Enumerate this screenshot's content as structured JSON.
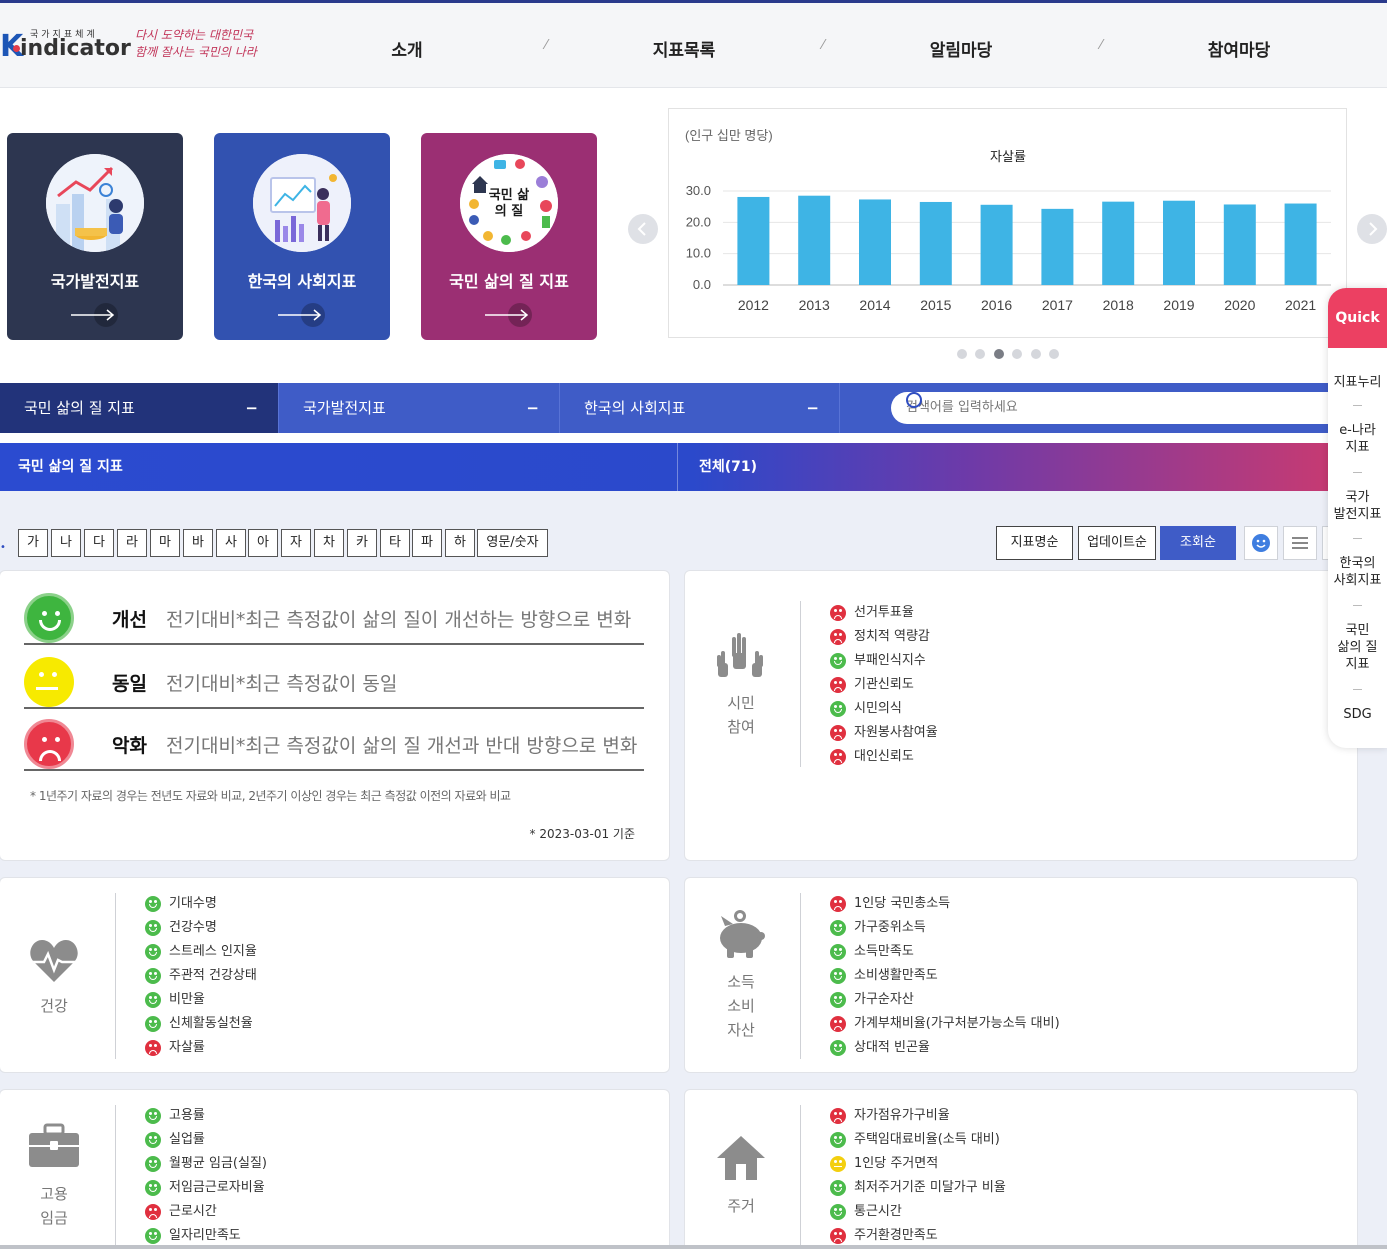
{
  "header": {
    "logo_small": "국가지표체계",
    "logo_text": "indicator",
    "logo_letter": "K",
    "slogan_line1": "다시 도약하는 대한민국",
    "slogan_line2": "함께 잘사는 국민의 나라",
    "nav": [
      "소개",
      "지표목록",
      "알림마당",
      "참여마당"
    ]
  },
  "cards": [
    {
      "title": "국가발전지표",
      "color": "#2d3650"
    },
    {
      "title": "한국의 사회지표",
      "color": "#3252b0"
    },
    {
      "title": "국민 삶의 질 지표",
      "color": "#9b2f73",
      "circle_text": "국민 삶의 질"
    }
  ],
  "chart_data": {
    "type": "bar",
    "title": "자살률",
    "unit_label": "(인구 십만 명당)",
    "categories": [
      "2012",
      "2013",
      "2014",
      "2015",
      "2016",
      "2017",
      "2018",
      "2019",
      "2020",
      "2021"
    ],
    "values": [
      28.1,
      28.5,
      27.3,
      26.5,
      25.6,
      24.3,
      26.6,
      26.9,
      25.7,
      26.0
    ],
    "yticks": [
      "0.0",
      "10.0",
      "20.0",
      "30.0"
    ],
    "ylim": [
      0,
      30
    ],
    "bar_color": "#3eb4e5",
    "grid": true
  },
  "slider": {
    "dots": 6,
    "active": 2
  },
  "tabs": [
    {
      "label": "국민 삶의 질 지표",
      "active": true
    },
    {
      "label": "국가발전지표",
      "active": false
    },
    {
      "label": "한국의 사회지표",
      "active": false
    }
  ],
  "search": {
    "placeholder": "검색어를 입력하세요"
  },
  "subbar": {
    "left": "국민 삶의 질 지표",
    "right": "전체(71)"
  },
  "korean_index": [
    "가",
    "나",
    "다",
    "라",
    "마",
    "바",
    "사",
    "아",
    "자",
    "차",
    "카",
    "타",
    "파",
    "하",
    "영문/숫자"
  ],
  "sort_buttons": [
    {
      "label": "지표명순",
      "active": false
    },
    {
      "label": "업데이트순",
      "active": false
    },
    {
      "label": "조회순",
      "active": true
    }
  ],
  "legend": {
    "rows": [
      {
        "status": "good",
        "label": "개선",
        "desc": "전기대비*최근 측정값이 삶의 질이 개선하는 방향으로 변화"
      },
      {
        "status": "same",
        "label": "동일",
        "desc": "전기대비*최근 측정값이 동일"
      },
      {
        "status": "bad",
        "label": "악화",
        "desc": "전기대비*최근 측정값이 삶의 질 개선과 반대 방향으로 변화"
      }
    ],
    "footnote": "* 1년주기 자료의 경우는 전년도 자료와 비교, 2년주기 이상인 경우는 최근 측정값 이전의 자료와 비교",
    "date": "* 2023-03-01 기준"
  },
  "categories": [
    {
      "key": "civic",
      "label_lines": [
        "시민",
        "참여"
      ],
      "icon": "raised-hands-icon",
      "items": [
        {
          "name": "선거투표율",
          "status": "bad"
        },
        {
          "name": "정치적 역량감",
          "status": "bad"
        },
        {
          "name": "부패인식지수",
          "status": "good"
        },
        {
          "name": "기관신뢰도",
          "status": "bad"
        },
        {
          "name": "시민의식",
          "status": "good"
        },
        {
          "name": "자원봉사참여율",
          "status": "bad"
        },
        {
          "name": "대인신뢰도",
          "status": "bad"
        }
      ]
    },
    {
      "key": "health",
      "label_lines": [
        "건강"
      ],
      "icon": "heart-pulse-icon",
      "items": [
        {
          "name": "기대수명",
          "status": "good"
        },
        {
          "name": "건강수명",
          "status": "good"
        },
        {
          "name": "스트레스 인지율",
          "status": "good"
        },
        {
          "name": "주관적 건강상태",
          "status": "good"
        },
        {
          "name": "비만율",
          "status": "good"
        },
        {
          "name": "신체활동실천율",
          "status": "good"
        },
        {
          "name": "자살률",
          "status": "bad"
        }
      ]
    },
    {
      "key": "income",
      "label_lines": [
        "소득",
        "소비",
        "자산"
      ],
      "icon": "piggy-bank-icon",
      "items": [
        {
          "name": "1인당 국민총소득",
          "status": "bad"
        },
        {
          "name": "가구중위소득",
          "status": "good"
        },
        {
          "name": "소득만족도",
          "status": "good"
        },
        {
          "name": "소비생활만족도",
          "status": "good"
        },
        {
          "name": "가구순자산",
          "status": "good"
        },
        {
          "name": "가계부채비율(가구처분가능소득 대비)",
          "status": "bad"
        },
        {
          "name": "상대적 빈곤율",
          "status": "good"
        }
      ]
    },
    {
      "key": "employment",
      "label_lines": [
        "고용",
        "임금"
      ],
      "icon": "briefcase-icon",
      "items": [
        {
          "name": "고용률",
          "status": "good"
        },
        {
          "name": "실업률",
          "status": "good"
        },
        {
          "name": "월평균 임금(실질)",
          "status": "good"
        },
        {
          "name": "저임금근로자비율",
          "status": "good"
        },
        {
          "name": "근로시간",
          "status": "bad"
        },
        {
          "name": "일자리만족도",
          "status": "good"
        }
      ]
    },
    {
      "key": "housing",
      "label_lines": [
        "주거"
      ],
      "icon": "house-icon",
      "items": [
        {
          "name": "자가점유가구비율",
          "status": "bad"
        },
        {
          "name": "주택임대료비율(소득 대비)",
          "status": "good"
        },
        {
          "name": "1인당 주거면적",
          "status": "same"
        },
        {
          "name": "최저주거기준 미달가구 비율",
          "status": "good"
        },
        {
          "name": "통근시간",
          "status": "good"
        },
        {
          "name": "주거환경만족도",
          "status": "bad"
        }
      ]
    }
  ],
  "quick": {
    "title": "Quick",
    "items": [
      [
        "지표누리"
      ],
      [
        "e-나라",
        "지표"
      ],
      [
        "국가",
        "발전지표"
      ],
      [
        "한국의",
        "사회지표"
      ],
      [
        "국민",
        "삶의 질",
        "지표"
      ],
      [
        "SDG"
      ]
    ]
  }
}
